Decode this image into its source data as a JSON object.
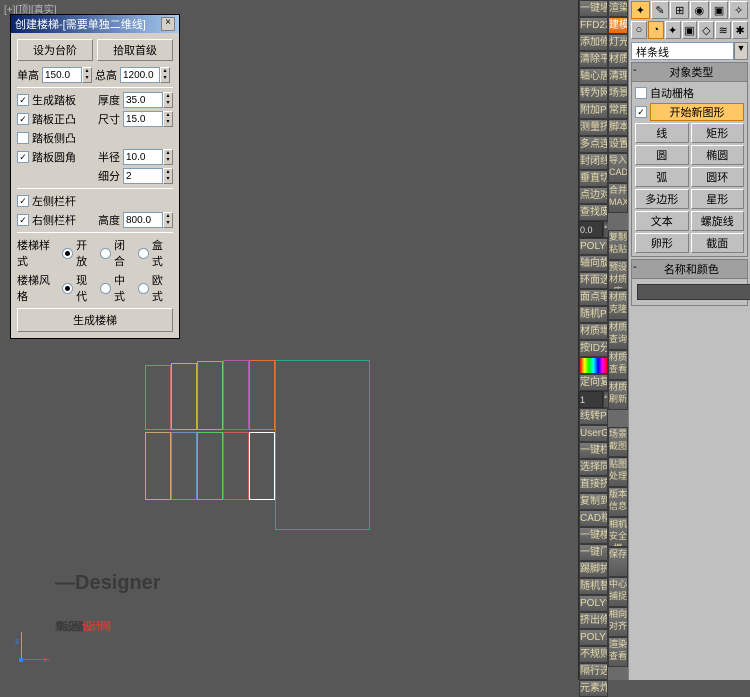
{
  "viewport": {
    "label": "[+][顶][真实]"
  },
  "dialog": {
    "title": "创建楼梯-[需要单独二维线]",
    "btn_step": "设为台阶",
    "btn_pick": "拾取首级",
    "l_single_h": "单高",
    "v_single_h": "150.0",
    "l_total_h": "总高",
    "v_total_h": "1200.0",
    "chk_board": "生成踏板",
    "l_thick": "厚度",
    "v_thick": "35.0",
    "chk_convex": "踏板正凸",
    "l_size": "尺寸",
    "v_size": "15.0",
    "chk_concave": "踏板侧凸",
    "chk_round": "踏板圆角",
    "l_radius": "半径",
    "v_radius": "10.0",
    "l_seg": "细分",
    "v_seg": "2",
    "chk_left": "左侧栏杆",
    "chk_right": "右侧栏杆",
    "l_height": "高度",
    "v_height": "800.0",
    "l_style": "楼梯样式",
    "r_open": "开放",
    "r_closed": "闭合",
    "r_box": "盒式",
    "l_mode": "楼梯风格",
    "r_modern": "现代",
    "r_mid": "中式",
    "r_euro": "欧式",
    "btn_gen": "生成楼梯"
  },
  "col1": [
    "一键墙体",
    "FFD2X2*",
    "添加修改",
    "清除平滑",
    "轴心居中",
    "转为网格",
    "附加POLY*",
    "测量挤出",
    "多点连接",
    "封闭线条",
    "垂直切边",
    "点边对齐",
    "查找废点"
  ],
  "col1b": [
    "POLY分段*",
    "轴向旋转",
    "环面选择",
    "面点笔刷",
    "随机POLY",
    "材质塌陷",
    "按ID分离"
  ],
  "col1c": [
    "定向复制",
    "线转POLY",
    "UserGrid",
    "一键栏杆",
    "选择同色",
    "直接挤出",
    "复制到点",
    "CAD楼梯",
    "一键楼梯",
    "一键门",
    "踢脚护墙",
    "随机替换",
    "POLY切片",
    "挤出修复",
    "POLY工具",
    "不规则阵",
    "隔行选择",
    "元素炸开"
  ],
  "col2": [
    "渲染",
    "建模",
    "灯光",
    "材质",
    "清理",
    "场景",
    "常用",
    "脚本",
    "设置"
  ],
  "col2_single": [
    "导入\nCAD",
    "合并\nMAX"
  ],
  "col2b": [
    "复制\n粘贴",
    "预设\n材质库",
    "材质\n克隆",
    "材质\n查询",
    "材质\n查看",
    "材质\n刷新"
  ],
  "col2c": [
    "场景\n截图",
    "贴图\n处理",
    "版本\n信息",
    "相机\n安全框",
    "保存",
    "中心\n捕捉",
    "相向\n对齐",
    "渲染\n查看"
  ],
  "num0": "0.0",
  "p_label": "P",
  "num1": "1",
  "rpanel": {
    "dropdown": "样条线",
    "rollout_obj": "对象类型",
    "chk_autogrid": "自动栅格",
    "chk_startshape": "开始新图形",
    "buttons": [
      "线",
      "矩形",
      "圆",
      "椭圆",
      "弧",
      "圆环",
      "多边形",
      "星形",
      "文本",
      "螺旋线",
      "卵形",
      "截面"
    ],
    "rollout_name": "名称和颜色"
  },
  "watermark_d": "—Designer",
  "watermark_main_a": "集设屋",
  "watermark_main_b": "设计网"
}
